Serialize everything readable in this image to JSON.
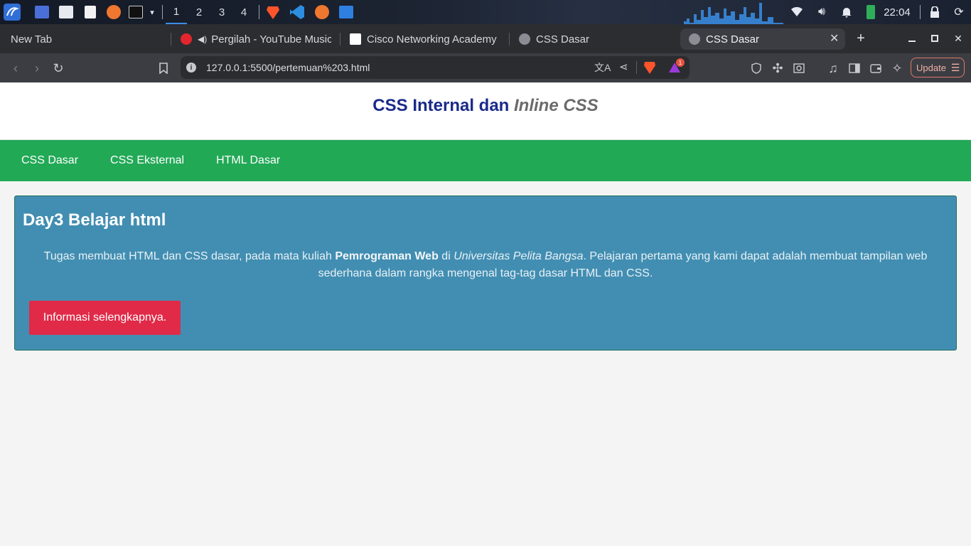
{
  "os_panel": {
    "workspaces": [
      "1",
      "2",
      "3",
      "4"
    ],
    "active_workspace": "1",
    "clock": "22:04",
    "launchers": [
      "desktop-icon",
      "files-icon",
      "text-editor-icon",
      "firefox-icon",
      "terminal-icon"
    ],
    "pinned_apps": [
      "brave-icon",
      "vscode-icon",
      "firefox-icon",
      "home-folder-icon"
    ]
  },
  "browser": {
    "tabs": [
      {
        "title": "New Tab"
      },
      {
        "title": "Pergilah - YouTube Music"
      },
      {
        "title": "Cisco Networking Academy"
      },
      {
        "title": "CSS Dasar"
      },
      {
        "title": "CSS Dasar"
      }
    ],
    "active_tab": 4,
    "url": "127.0.0.1:5500/pertemuan%203.html",
    "update_label": "Update",
    "notification_count": "1"
  },
  "page": {
    "header": {
      "title_plain": "CSS Internal dan ",
      "title_italic": "Inline CSS"
    },
    "nav": [
      {
        "label": "CSS Dasar"
      },
      {
        "label": "CSS Eksternal"
      },
      {
        "label": "HTML Dasar"
      }
    ],
    "card": {
      "heading": "Day3 Belajar html",
      "text_1": "Tugas membuat HTML dan CSS dasar, pada mata kuliah ",
      "text_bold": "Pemrograman Web",
      "text_2": " di ",
      "text_italic": "Universitas Pelita Bangsa",
      "text_3": ". Pelajaran pertama yang kami dapat adalah membuat tampilan web sederhana dalam rangka mengenal tag-tag dasar HTML dan CSS.",
      "button_label": "Informasi selengkapnya."
    }
  },
  "colors": {
    "nav_bg": "#22a956",
    "card_bg": "#428eb2",
    "button_bg": "#e02a48",
    "title_color": "#1a2a8a"
  }
}
